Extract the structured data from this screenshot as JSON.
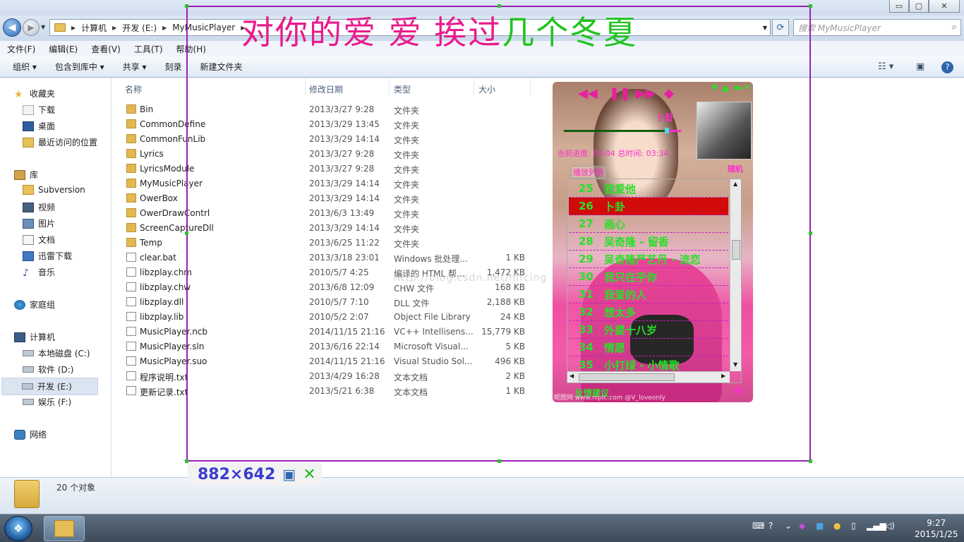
{
  "window": {
    "controls": [
      "▭",
      "▢",
      "✕"
    ]
  },
  "address": {
    "breadcrumb": [
      "计算机",
      "开发 (E:)",
      "MyMusicPlayer"
    ],
    "search_placeholder": "搜索 MyMusicPlayer"
  },
  "menu": [
    "文件(F)",
    "编辑(E)",
    "查看(V)",
    "工具(T)",
    "帮助(H)"
  ],
  "toolbar": [
    "组织 ▾",
    "包含到库中 ▾",
    "共享 ▾",
    "刻录",
    "新建文件夹"
  ],
  "nav": {
    "favorites": "收藏夹",
    "fav_items": [
      "下载",
      "桌面",
      "最近访问的位置"
    ],
    "libraries": "库",
    "lib_items": [
      "Subversion",
      "视频",
      "图片",
      "文档",
      "迅雷下载",
      "音乐"
    ],
    "homegroup": "家庭组",
    "computer": "计算机",
    "drives": [
      "本地磁盘 (C:)",
      "软件 (D:)",
      "开发 (E:)",
      "娱乐 (F:)"
    ],
    "network": "网络"
  },
  "columns": {
    "name": "名称",
    "date": "修改日期",
    "type": "类型",
    "size": "大小"
  },
  "files": [
    {
      "name": "Bin",
      "date": "2013/3/27 9:28",
      "type": "文件夹",
      "size": "",
      "kind": "folder"
    },
    {
      "name": "CommonDefine",
      "date": "2013/3/29 13:45",
      "type": "文件夹",
      "size": "",
      "kind": "folder"
    },
    {
      "name": "CommonFunLib",
      "date": "2013/3/29 14:14",
      "type": "文件夹",
      "size": "",
      "kind": "folder"
    },
    {
      "name": "Lyrics",
      "date": "2013/3/27 9:28",
      "type": "文件夹",
      "size": "",
      "kind": "folder"
    },
    {
      "name": "LyricsModule",
      "date": "2013/3/27 9:28",
      "type": "文件夹",
      "size": "",
      "kind": "folder"
    },
    {
      "name": "MyMusicPlayer",
      "date": "2013/3/29 14:14",
      "type": "文件夹",
      "size": "",
      "kind": "folder"
    },
    {
      "name": "OwerBox",
      "date": "2013/3/29 14:14",
      "type": "文件夹",
      "size": "",
      "kind": "folder"
    },
    {
      "name": "OwerDrawContrl",
      "date": "2013/6/3 13:49",
      "type": "文件夹",
      "size": "",
      "kind": "folder"
    },
    {
      "name": "ScreenCaptureDll",
      "date": "2013/3/29 14:14",
      "type": "文件夹",
      "size": "",
      "kind": "folder"
    },
    {
      "name": "Temp",
      "date": "2013/6/25 11:22",
      "type": "文件夹",
      "size": "",
      "kind": "folder"
    },
    {
      "name": "clear.bat",
      "date": "2013/3/18 23:01",
      "type": "Windows 批处理...",
      "size": "1 KB",
      "kind": "file"
    },
    {
      "name": "libzplay.chm",
      "date": "2010/5/7 4:25",
      "type": "编译的 HTML 帮...",
      "size": "1,472 KB",
      "kind": "file"
    },
    {
      "name": "libzplay.chw",
      "date": "2013/6/8 12:09",
      "type": "CHW 文件",
      "size": "168 KB",
      "kind": "file"
    },
    {
      "name": "libzplay.dll",
      "date": "2010/5/7 7:10",
      "type": "DLL 文件",
      "size": "2,188 KB",
      "kind": "file"
    },
    {
      "name": "libzplay.lib",
      "date": "2010/5/2 2:07",
      "type": "Object File Library",
      "size": "24 KB",
      "kind": "file"
    },
    {
      "name": "MusicPlayer.ncb",
      "date": "2014/11/15 21:16",
      "type": "VC++ Intellisens...",
      "size": "15,779 KB",
      "kind": "file"
    },
    {
      "name": "MusicPlayer.sln",
      "date": "2013/6/16 22:14",
      "type": "Microsoft Visual...",
      "size": "5 KB",
      "kind": "file"
    },
    {
      "name": "MusicPlayer.suo",
      "date": "2014/11/15 21:16",
      "type": "Visual Studio Sol...",
      "size": "496 KB",
      "kind": "file"
    },
    {
      "name": "程序说明.txt",
      "date": "2013/4/29 16:28",
      "type": "文本文档",
      "size": "2 KB",
      "kind": "file"
    },
    {
      "name": "更新记录.txt",
      "date": "2013/5/21 6:38",
      "type": "文本文档",
      "size": "1 KB",
      "kind": "file"
    }
  ],
  "status": {
    "count": "20 个对象"
  },
  "clock": {
    "time": "9:27",
    "date": "2015/1/25"
  },
  "overlay": {
    "lyric_pink": "对你的爱 爱 挨过",
    "lyric_green": "几个冬夏",
    "size_label": "882×642"
  },
  "watermark": "http://blog.csdn.net/mfcing",
  "player": {
    "song": "卜卦",
    "progress": 0.88,
    "time_text": "当前进度: 03:04  总时间: 03:34",
    "mode": "随机",
    "playlist_tab": "播放列表",
    "feedback": "反馈建议",
    "photo_credit": "昵图网 www.nipic.com  @V_loveonly",
    "colors": {
      "accent": "#ff2ccb",
      "text": "#28e028",
      "current": "#d10b0b"
    },
    "playlist": [
      {
        "n": "25",
        "t": "我爱他"
      },
      {
        "n": "26",
        "t": "卜卦",
        "current": true
      },
      {
        "n": "27",
        "t": "画心"
      },
      {
        "n": "28",
        "t": "吴奇隆 - 留香"
      },
      {
        "n": "29",
        "t": "吴奇隆严艺丹 - 流恋"
      },
      {
        "n": "30",
        "t": "我只在乎你"
      },
      {
        "n": "31",
        "t": "我爱的人"
      },
      {
        "n": "32",
        "t": "想太多"
      },
      {
        "n": "33",
        "t": "外婆十八岁"
      },
      {
        "n": "34",
        "t": "情愿"
      },
      {
        "n": "35",
        "t": "小打绿 - 小情歌"
      }
    ]
  }
}
